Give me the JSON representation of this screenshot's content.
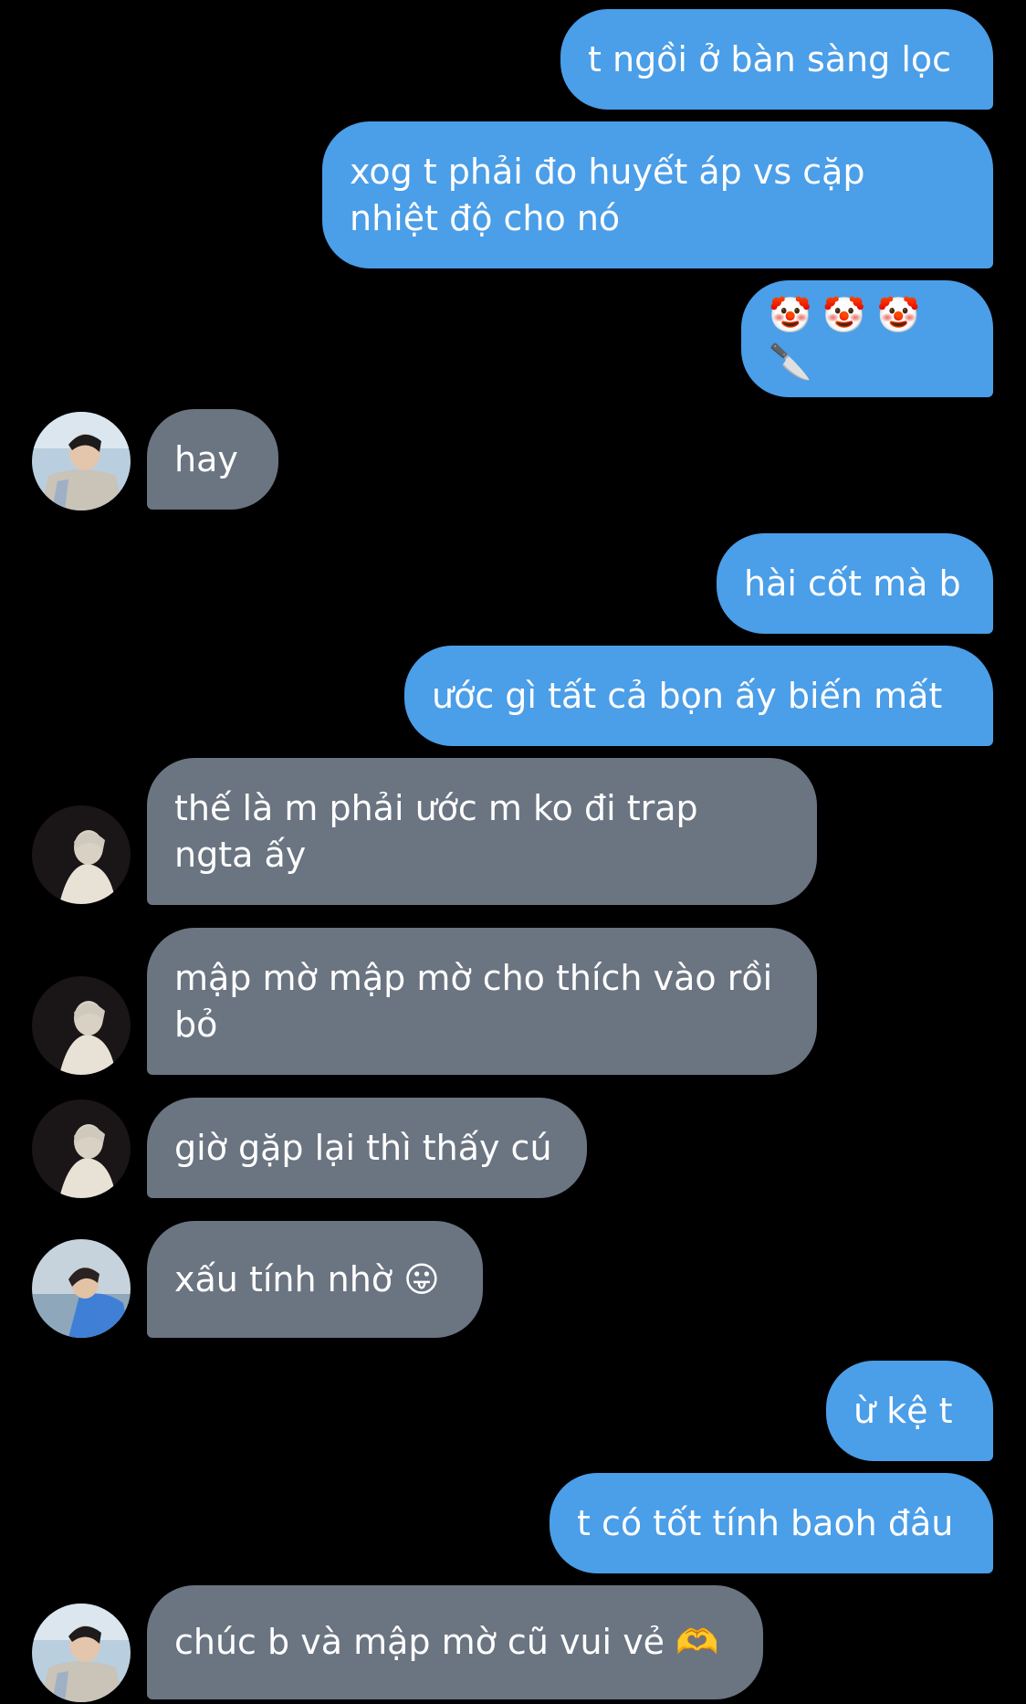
{
  "messages": [
    {
      "id": "m1",
      "direction": "outgoing",
      "text": "t ngồi ở bàn sàng lọc"
    },
    {
      "id": "m2",
      "direction": "outgoing",
      "text": "xog t phải đo huyết áp vs cặp\nnhiệt độ cho nó"
    },
    {
      "id": "m3",
      "direction": "outgoing",
      "text": "🤡 🤡 🤡 🔪"
    },
    {
      "id": "m4",
      "direction": "incoming",
      "text": "hay",
      "avatar": "boy-plaid-avatar"
    },
    {
      "id": "m5",
      "direction": "outgoing",
      "text": "hài cốt mà b"
    },
    {
      "id": "m6",
      "direction": "outgoing",
      "text": "ước gì tất cả bọn ấy biến mất"
    },
    {
      "id": "m7",
      "direction": "incoming",
      "text": "thế là m phải ước m ko đi trap\nngta ấy",
      "avatar": "blonde-dark-avatar"
    },
    {
      "id": "m8",
      "direction": "incoming",
      "text": "mập mờ mập mờ cho thích vào rồi\nbỏ",
      "avatar": "blonde-dark-avatar"
    },
    {
      "id": "m9",
      "direction": "incoming",
      "text": "giờ gặp lại thì thấy cú",
      "avatar": "blonde-dark-avatar"
    },
    {
      "id": "m10",
      "direction": "incoming",
      "text": "xấu tính nhờ 😛",
      "avatar": "blue-jacket-avatar"
    },
    {
      "id": "m11",
      "direction": "outgoing",
      "text": "ừ kệ t"
    },
    {
      "id": "m12",
      "direction": "outgoing",
      "text": "t có tốt tính baoh đâu"
    },
    {
      "id": "m13",
      "direction": "incoming",
      "text": "chúc b và mập mờ cũ vui vẻ 🫶",
      "avatar": "boy-plaid-avatar"
    }
  ],
  "colors": {
    "background": "#000000",
    "outgoing_bubble": "#4b9ee8",
    "incoming_bubble": "#6b7481",
    "text": "#ffffff"
  }
}
